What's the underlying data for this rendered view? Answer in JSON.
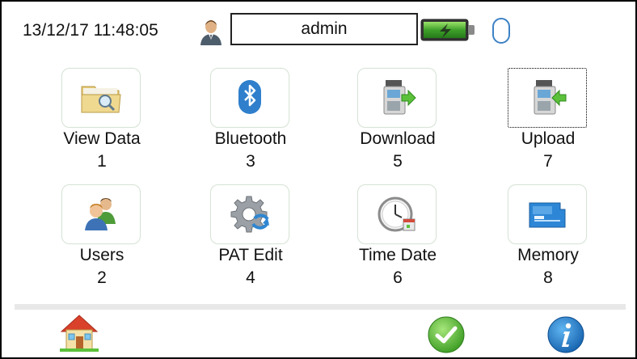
{
  "header": {
    "datetime": "13/12/17 11:48:05",
    "user_name": "admin"
  },
  "menu": [
    {
      "label": "View Data",
      "number": "1",
      "icon": "folder-search-icon"
    },
    {
      "label": "Bluetooth",
      "number": "3",
      "icon": "bluetooth-icon"
    },
    {
      "label": "Download",
      "number": "5",
      "icon": "download-icon"
    },
    {
      "label": "Upload",
      "number": "7",
      "icon": "upload-icon",
      "selected": true
    },
    {
      "label": "Users",
      "number": "2",
      "icon": "users-icon"
    },
    {
      "label": "PAT Edit",
      "number": "4",
      "icon": "gear-sync-icon"
    },
    {
      "label": "Time Date",
      "number": "6",
      "icon": "clock-calendar-icon"
    },
    {
      "label": "Memory",
      "number": "8",
      "icon": "microsd-card-icon"
    }
  ],
  "colors": {
    "accent_green": "#4cb84a",
    "info_blue": "#1f7ac8",
    "tile_border": "#d8e4d8"
  }
}
